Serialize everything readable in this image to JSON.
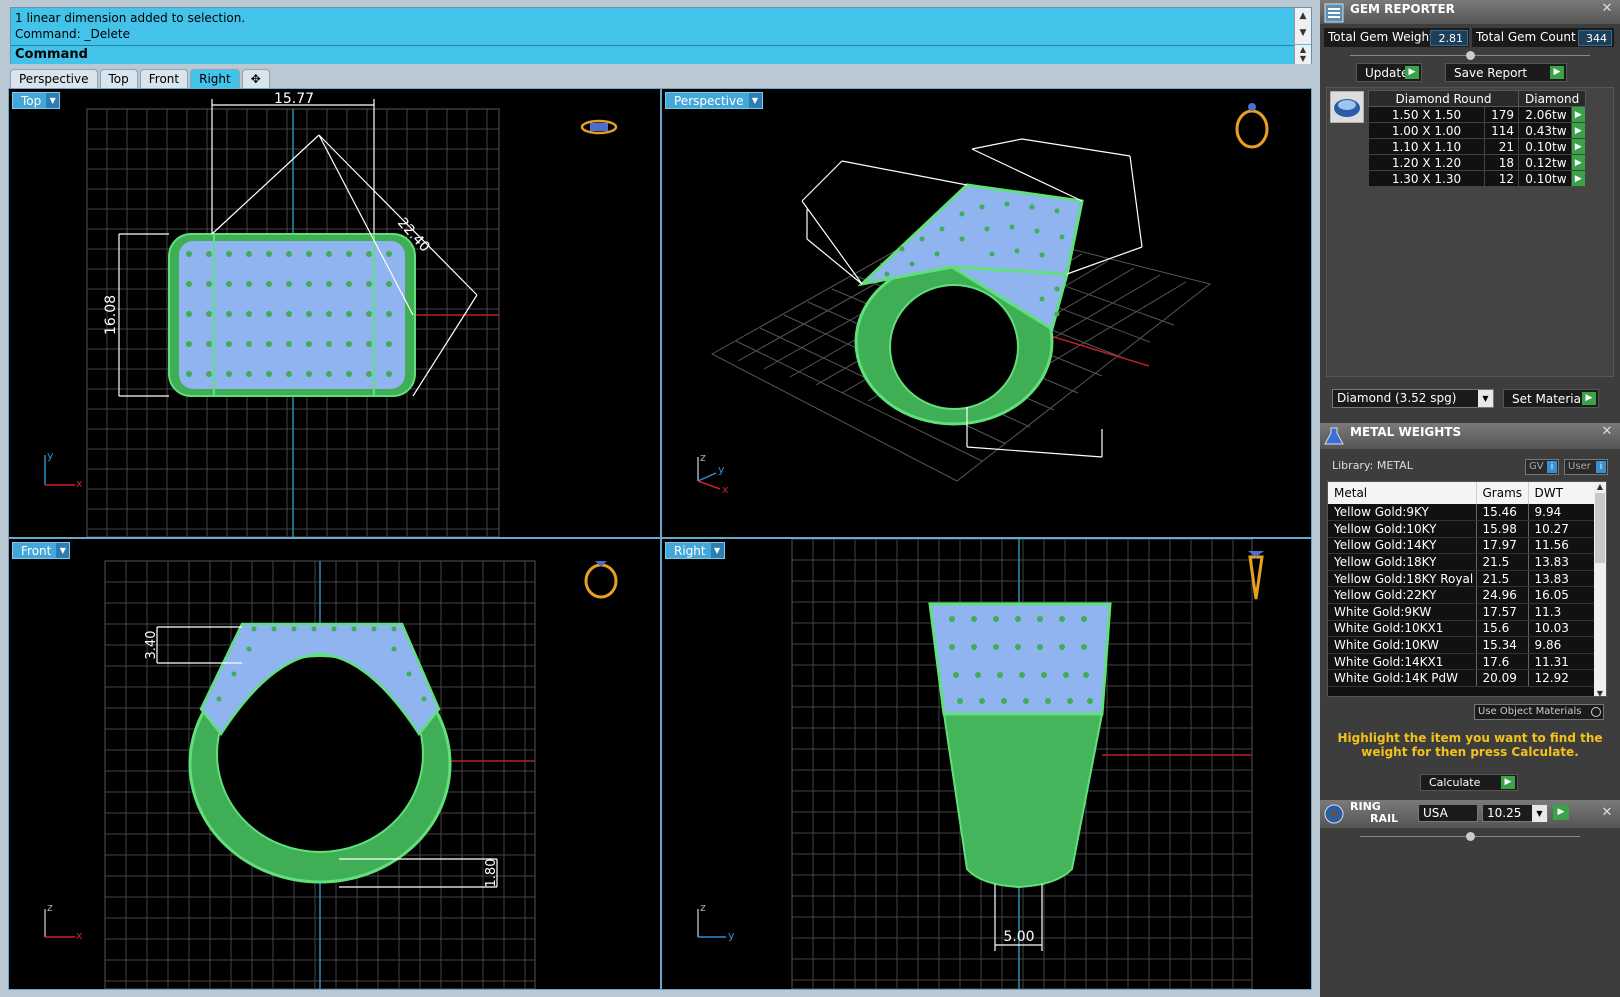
{
  "command": {
    "history": [
      "1 linear dimension added to selection.",
      "Command: _Delete"
    ],
    "prompt_label": "Command:"
  },
  "viewport_tabs": [
    "Perspective",
    "Top",
    "Front",
    "Right"
  ],
  "viewports": {
    "top": {
      "label": "Top",
      "dims": [
        "15.77",
        "22.40",
        "16.08"
      ]
    },
    "perspective": {
      "label": "Perspective"
    },
    "front": {
      "label": "Front",
      "dims": [
        "3.40",
        "1.80"
      ]
    },
    "right": {
      "label": "Right",
      "dims": [
        "5.00"
      ]
    }
  },
  "gem_reporter": {
    "title": "GEM REPORTER",
    "total_weight_label": "Total Gem Weight",
    "total_weight_value": "2.81",
    "total_count_label": "Total Gem Count",
    "total_count_value": "344",
    "update_label": "Update",
    "save_report_label": "Save Report",
    "table_headers": [
      "Diamond Round",
      "Diamond"
    ],
    "rows": [
      {
        "size": "1.50 X 1.50",
        "count": "179",
        "weight": "2.06tw"
      },
      {
        "size": "1.00 X 1.00",
        "count": "114",
        "weight": "0.43tw"
      },
      {
        "size": "1.10 X 1.10",
        "count": "21",
        "weight": "0.10tw"
      },
      {
        "size": "1.20 X 1.20",
        "count": "18",
        "weight": "0.12tw"
      },
      {
        "size": "1.30 X 1.30",
        "count": "12",
        "weight": "0.10tw"
      }
    ],
    "material_select": "Diamond    (3.52 spg)",
    "set_material_label": "Set Material"
  },
  "metal_weights": {
    "title": "METAL WEIGHTS",
    "library_label": "Library: METAL",
    "gv_label": "GV",
    "user_label": "User",
    "headers": [
      "Metal",
      "Grams",
      "DWT"
    ],
    "rows": [
      [
        "Yellow Gold:9KY",
        "15.46",
        "9.94"
      ],
      [
        "Yellow Gold:10KY",
        "15.98",
        "10.27"
      ],
      [
        "Yellow Gold:14KY",
        "17.97",
        "11.56"
      ],
      [
        "Yellow Gold:18KY",
        "21.5",
        "13.83"
      ],
      [
        "Yellow Gold:18KY Royal",
        "21.5",
        "13.83"
      ],
      [
        "Yellow Gold:22KY",
        "24.96",
        "16.05"
      ],
      [
        "White Gold:9KW",
        "17.57",
        "11.3"
      ],
      [
        "White Gold:10KX1",
        "15.6",
        "10.03"
      ],
      [
        "White Gold:10KW",
        "15.34",
        "9.86"
      ],
      [
        "White Gold:14KX1",
        "17.6",
        "11.31"
      ],
      [
        "White Gold:14K PdW",
        "20.09",
        "12.92"
      ]
    ],
    "use_object_materials": "Use Object Materials",
    "hint": "Highlight the item you want to find the weight for then press Calculate.",
    "calculate_label": "Calculate"
  },
  "ring_rail": {
    "title_line1": "RING",
    "title_line2": "RAIL",
    "country": "USA",
    "size": "10.25"
  },
  "colors": {
    "accent": "#44c3ea",
    "ring_green": "#4fc86a",
    "gem_blue": "#8fb4f0",
    "hint_yellow": "#f2c21b"
  }
}
